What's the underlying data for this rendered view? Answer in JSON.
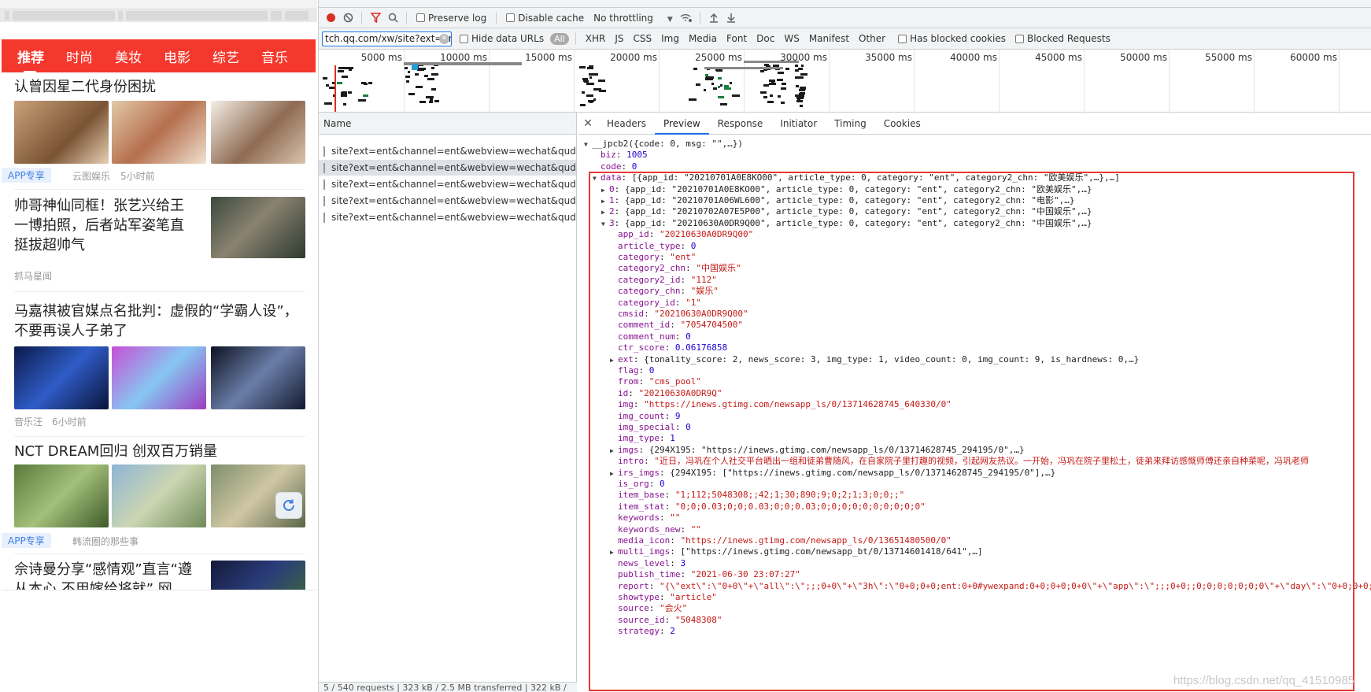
{
  "left": {
    "nav_tabs": [
      "推荐",
      "时尚",
      "美妆",
      "电影",
      "综艺",
      "音乐"
    ],
    "articles": [
      {
        "title_lines": [
          "认曾因星二代身份困扰"
        ],
        "tag": "APP专享",
        "source": "云图娱乐",
        "time": "5小时前"
      },
      {
        "title_lines": [
          "帅哥神仙同框！张艺兴给王",
          "一博拍照，后者站军姿笔直",
          "挺拔超帅气"
        ],
        "source": "抓马星闻"
      },
      {
        "title_lines": [
          "马嘉祺被官媒点名批判：虚假的“学霸人设”，",
          "不要再误人子弟了"
        ],
        "source": "音乐汪",
        "time": "6小时前"
      },
      {
        "title_lines": [
          "NCT DREAM回归 创双百万销量"
        ],
        "tag": "APP专享",
        "source": "韩流圈的那些事"
      },
      {
        "title_lines": [
          "佘诗曼分享“感情观”直言“遵",
          "从本心 不用嫁给将就” 网"
        ]
      }
    ],
    "refresh_icon": "refresh-icon"
  },
  "devtools": {
    "toolbar": {
      "preserve_log": "Preserve log",
      "disable_cache": "Disable cache",
      "throttling": "No throttling"
    },
    "filter": {
      "value": "tch.qq.com/xw/site?ext=ent",
      "hide_data_urls": "Hide data URLs",
      "types": [
        "All",
        "XHR",
        "JS",
        "CSS",
        "Img",
        "Media",
        "Font",
        "Doc",
        "WS",
        "Manifest",
        "Other"
      ],
      "has_blocked_cookies": "Has blocked cookies",
      "blocked_requests": "Blocked Requests"
    },
    "timeline_labels": [
      "5000 ms",
      "10000 ms",
      "15000 ms",
      "20000 ms",
      "25000 ms",
      "30000 ms",
      "35000 ms",
      "40000 ms",
      "45000 ms",
      "50000 ms",
      "55000 ms",
      "60000 ms"
    ],
    "name_header": "Name",
    "requests": [
      "site?ext=ent&channel=ent&webview=wechat&qudao...",
      "site?ext=ent&channel=ent&webview=wechat&qudao...",
      "site?ext=ent&channel=ent&webview=wechat&qudao...",
      "site?ext=ent&channel=ent&webview=wechat&qudao...",
      "site?ext=ent&channel=ent&webview=wechat&qudao..."
    ],
    "status": "5 / 540 requests  |  323 kB / 2.5 MB transferred  |  322 kB /",
    "detail_tabs": [
      "Headers",
      "Preview",
      "Response",
      "Initiator",
      "Timing",
      "Cookies"
    ],
    "json_lines": [
      {
        "t": "▼",
        "indent": 0,
        "parts": [
          [
            "p",
            "__jpcb2({code: 0, msg: \"\",…})"
          ]
        ]
      },
      {
        "t": "",
        "indent": 1,
        "parts": [
          [
            "k",
            "biz"
          ],
          [
            "p",
            ": "
          ],
          [
            "n",
            "1005"
          ]
        ]
      },
      {
        "t": "",
        "indent": 1,
        "parts": [
          [
            "k",
            "code"
          ],
          [
            "p",
            ": "
          ],
          [
            "n",
            "0"
          ]
        ]
      },
      {
        "t": "▼",
        "indent": 1,
        "parts": [
          [
            "k",
            "data"
          ],
          [
            "p",
            ": [{app_id: \"20210701A0E8KO00\", article_type: 0, category: \"ent\", category2_chn: \"欧美娱乐\",…},…]"
          ]
        ]
      },
      {
        "t": "▶",
        "indent": 2,
        "parts": [
          [
            "k",
            "0"
          ],
          [
            "p",
            ": {app_id: \"20210701A0E8KO00\", article_type: 0, category: \"ent\", category2_chn: \"欧美娱乐\",…}"
          ]
        ]
      },
      {
        "t": "▶",
        "indent": 2,
        "parts": [
          [
            "k",
            "1"
          ],
          [
            "p",
            ": {app_id: \"20210701A06WL600\", article_type: 0, category: \"ent\", category2_chn: \"电影\",…}"
          ]
        ]
      },
      {
        "t": "▶",
        "indent": 2,
        "parts": [
          [
            "k",
            "2"
          ],
          [
            "p",
            ": {app_id: \"20210702A07E5P00\", article_type: 0, category: \"ent\", category2_chn: \"中国娱乐\",…}"
          ]
        ]
      },
      {
        "t": "▼",
        "indent": 2,
        "parts": [
          [
            "k",
            "3"
          ],
          [
            "p",
            ": {app_id: \"20210630A0DR9Q00\", article_type: 0, category: \"ent\", category2_chn: \"中国娱乐\",…}"
          ]
        ]
      },
      {
        "t": "",
        "indent": 3,
        "parts": [
          [
            "k",
            "app_id"
          ],
          [
            "p",
            ": "
          ],
          [
            "s",
            "\"20210630A0DR9Q00\""
          ]
        ]
      },
      {
        "t": "",
        "indent": 3,
        "parts": [
          [
            "k",
            "article_type"
          ],
          [
            "p",
            ": "
          ],
          [
            "n",
            "0"
          ]
        ]
      },
      {
        "t": "",
        "indent": 3,
        "parts": [
          [
            "k",
            "category"
          ],
          [
            "p",
            ": "
          ],
          [
            "s",
            "\"ent\""
          ]
        ]
      },
      {
        "t": "",
        "indent": 3,
        "parts": [
          [
            "k",
            "category2_chn"
          ],
          [
            "p",
            ": "
          ],
          [
            "s",
            "\"中国娱乐\""
          ]
        ]
      },
      {
        "t": "",
        "indent": 3,
        "parts": [
          [
            "k",
            "category2_id"
          ],
          [
            "p",
            ": "
          ],
          [
            "s",
            "\"112\""
          ]
        ]
      },
      {
        "t": "",
        "indent": 3,
        "parts": [
          [
            "k",
            "category_chn"
          ],
          [
            "p",
            ": "
          ],
          [
            "s",
            "\"娱乐\""
          ]
        ]
      },
      {
        "t": "",
        "indent": 3,
        "parts": [
          [
            "k",
            "category_id"
          ],
          [
            "p",
            ": "
          ],
          [
            "s",
            "\"1\""
          ]
        ]
      },
      {
        "t": "",
        "indent": 3,
        "parts": [
          [
            "k",
            "cmsid"
          ],
          [
            "p",
            ": "
          ],
          [
            "s",
            "\"20210630A0DR9Q00\""
          ]
        ]
      },
      {
        "t": "",
        "indent": 3,
        "parts": [
          [
            "k",
            "comment_id"
          ],
          [
            "p",
            ": "
          ],
          [
            "s",
            "\"7054704500\""
          ]
        ]
      },
      {
        "t": "",
        "indent": 3,
        "parts": [
          [
            "k",
            "comment_num"
          ],
          [
            "p",
            ": "
          ],
          [
            "n",
            "0"
          ]
        ]
      },
      {
        "t": "",
        "indent": 3,
        "parts": [
          [
            "k",
            "ctr_score"
          ],
          [
            "p",
            ": "
          ],
          [
            "n",
            "0.06176858"
          ]
        ]
      },
      {
        "t": "▶",
        "indent": 3,
        "parts": [
          [
            "k",
            "ext"
          ],
          [
            "p",
            ": {tonality_score: 2, news_score: 3, img_type: 1, video_count: 0, img_count: 9, is_hardnews: 0,…}"
          ]
        ]
      },
      {
        "t": "",
        "indent": 3,
        "parts": [
          [
            "k",
            "flag"
          ],
          [
            "p",
            ": "
          ],
          [
            "n",
            "0"
          ]
        ]
      },
      {
        "t": "",
        "indent": 3,
        "parts": [
          [
            "k",
            "from"
          ],
          [
            "p",
            ": "
          ],
          [
            "s",
            "\"cms_pool\""
          ]
        ]
      },
      {
        "t": "",
        "indent": 3,
        "parts": [
          [
            "k",
            "id"
          ],
          [
            "p",
            ": "
          ],
          [
            "s",
            "\"20210630A0DR9Q\""
          ]
        ]
      },
      {
        "t": "",
        "indent": 3,
        "parts": [
          [
            "k",
            "img"
          ],
          [
            "p",
            ": "
          ],
          [
            "s",
            "\"https://inews.gtimg.com/newsapp_ls/0/13714628745_640330/0\""
          ]
        ]
      },
      {
        "t": "",
        "indent": 3,
        "parts": [
          [
            "k",
            "img_count"
          ],
          [
            "p",
            ": "
          ],
          [
            "n",
            "9"
          ]
        ]
      },
      {
        "t": "",
        "indent": 3,
        "parts": [
          [
            "k",
            "img_special"
          ],
          [
            "p",
            ": "
          ],
          [
            "n",
            "0"
          ]
        ]
      },
      {
        "t": "",
        "indent": 3,
        "parts": [
          [
            "k",
            "img_type"
          ],
          [
            "p",
            ": "
          ],
          [
            "n",
            "1"
          ]
        ]
      },
      {
        "t": "▶",
        "indent": 3,
        "parts": [
          [
            "k",
            "imgs"
          ],
          [
            "p",
            ": {294X195: \"https://inews.gtimg.com/newsapp_ls/0/13714628745_294195/0\",…}"
          ]
        ]
      },
      {
        "t": "",
        "indent": 3,
        "parts": [
          [
            "k",
            "intro"
          ],
          [
            "p",
            ": "
          ],
          [
            "s",
            "\"近日，冯巩在个人社交平台晒出一组和徒弟曹随风，在自家院子里打趣的视频，引起网友热议。一开始，冯巩在院子里松土，徒弟来拜访感慨师傅还亲自种菜呢，冯巩老师"
          ]
        ]
      },
      {
        "t": "▶",
        "indent": 3,
        "parts": [
          [
            "k",
            "irs_imgs"
          ],
          [
            "p",
            ": {294X195: [\"https://inews.gtimg.com/newsapp_ls/0/13714628745_294195/0\"],…}"
          ]
        ]
      },
      {
        "t": "",
        "indent": 3,
        "parts": [
          [
            "k",
            "is_org"
          ],
          [
            "p",
            ": "
          ],
          [
            "n",
            "0"
          ]
        ]
      },
      {
        "t": "",
        "indent": 3,
        "parts": [
          [
            "k",
            "item_base"
          ],
          [
            "p",
            ": "
          ],
          [
            "s",
            "\"1;112;5048308;;42;1;30;890;9;0;2;1;3;0;0;;\""
          ]
        ]
      },
      {
        "t": "",
        "indent": 3,
        "parts": [
          [
            "k",
            "item_stat"
          ],
          [
            "p",
            ": "
          ],
          [
            "s",
            "\"0;0;0.03;0;0;0.03;0;0;0.03;0;0;0;0;0;0;0;0;0;0\""
          ]
        ]
      },
      {
        "t": "",
        "indent": 3,
        "parts": [
          [
            "k",
            "keywords"
          ],
          [
            "p",
            ": "
          ],
          [
            "s",
            "\"\""
          ]
        ]
      },
      {
        "t": "",
        "indent": 3,
        "parts": [
          [
            "k",
            "keywords_new"
          ],
          [
            "p",
            ": "
          ],
          [
            "s",
            "\"\""
          ]
        ]
      },
      {
        "t": "",
        "indent": 3,
        "parts": [
          [
            "k",
            "media_icon"
          ],
          [
            "p",
            ": "
          ],
          [
            "s",
            "\"https://inews.gtimg.com/newsapp_ls/0/13651480500/0\""
          ]
        ]
      },
      {
        "t": "▶",
        "indent": 3,
        "parts": [
          [
            "k",
            "multi_imgs"
          ],
          [
            "p",
            ": [\"https://inews.gtimg.com/newsapp_bt/0/13714601418/641\",…]"
          ]
        ]
      },
      {
        "t": "",
        "indent": 3,
        "parts": [
          [
            "k",
            "news_level"
          ],
          [
            "p",
            ": "
          ],
          [
            "n",
            "3"
          ]
        ]
      },
      {
        "t": "",
        "indent": 3,
        "parts": [
          [
            "k",
            "publish_time"
          ],
          [
            "p",
            ": "
          ],
          [
            "s",
            "\"2021-06-30 23:07:27\""
          ]
        ]
      },
      {
        "t": "",
        "indent": 3,
        "parts": [
          [
            "k",
            "report"
          ],
          [
            "p",
            ": "
          ],
          [
            "s",
            "\"{\\\"ext\\\":\\\"0+0\\\"+\\\"all\\\":\\\";;;0+0\\\"+\\\"3h\\\":\\\"0+0;0+0;ent:0+0#ywexpand:0+0;0+0;0+0\\\"+\\\"app\\\":\\\";;;0+0;;0;0;0;0;0;0;0\\\"+\\\"day\\\":\\\"0+0;0+0;"
          ]
        ]
      },
      {
        "t": "",
        "indent": 3,
        "parts": [
          [
            "k",
            "showtype"
          ],
          [
            "p",
            ": "
          ],
          [
            "s",
            "\"article\""
          ]
        ]
      },
      {
        "t": "",
        "indent": 3,
        "parts": [
          [
            "k",
            "source"
          ],
          [
            "p",
            ": "
          ],
          [
            "s",
            "\"会火\""
          ]
        ]
      },
      {
        "t": "",
        "indent": 3,
        "parts": [
          [
            "k",
            "source_id"
          ],
          [
            "p",
            ": "
          ],
          [
            "s",
            "\"5048308\""
          ]
        ]
      },
      {
        "t": "",
        "indent": 3,
        "parts": [
          [
            "k",
            "strategy"
          ],
          [
            "p",
            ": "
          ],
          [
            "n",
            "2"
          ]
        ]
      }
    ],
    "watermark": "https://blog.csdn.net/qq_41510985",
    "colors": {
      "highlight_box": "#e53935",
      "nav_red": "#f5382d",
      "tab_blue": "#1a73e8"
    }
  }
}
